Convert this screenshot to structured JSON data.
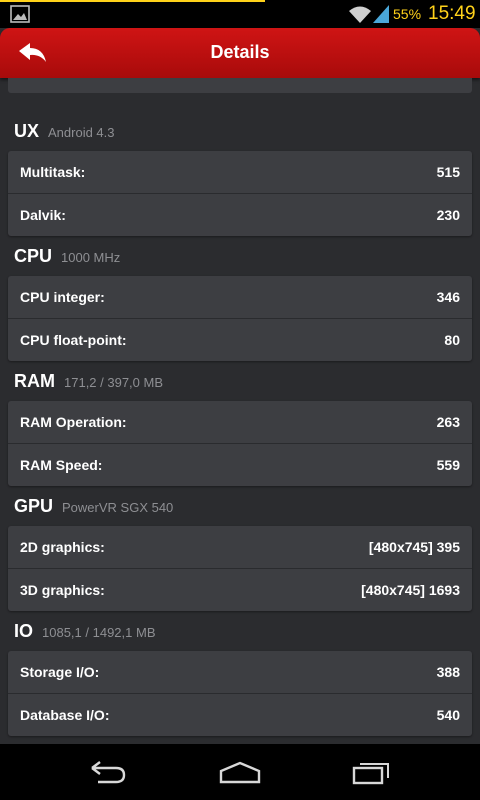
{
  "status_bar": {
    "battery_percent": "55%",
    "time": "15:49",
    "icons": [
      "gallery-icon",
      "wifi-icon",
      "signal-icon"
    ]
  },
  "header": {
    "title": "Details",
    "back_icon": "back-arrow-icon"
  },
  "sections": [
    {
      "title": "UX",
      "subtitle": "Android 4.3",
      "rows": [
        {
          "label": "Multitask:",
          "value": "515"
        },
        {
          "label": "Dalvik:",
          "value": "230"
        }
      ]
    },
    {
      "title": "CPU",
      "subtitle": "1000 MHz",
      "rows": [
        {
          "label": "CPU integer:",
          "value": "346"
        },
        {
          "label": "CPU float-point:",
          "value": "80"
        }
      ]
    },
    {
      "title": "RAM",
      "subtitle": "171,2 / 397,0 MB",
      "rows": [
        {
          "label": "RAM Operation:",
          "value": "263"
        },
        {
          "label": "RAM Speed:",
          "value": "559"
        }
      ]
    },
    {
      "title": "GPU",
      "subtitle": "PowerVR SGX 540",
      "rows": [
        {
          "label": "2D graphics:",
          "value": "[480x745] 395"
        },
        {
          "label": "3D graphics:",
          "value": "[480x745] 1693"
        }
      ]
    },
    {
      "title": "IO",
      "subtitle": "1085,1 / 1492,1 MB",
      "rows": [
        {
          "label": "Storage I/O:",
          "value": "388"
        },
        {
          "label": "Database I/O:",
          "value": "540"
        }
      ]
    }
  ],
  "nav_bar": {
    "icons": [
      "back-icon",
      "home-icon",
      "recents-icon"
    ]
  },
  "colors": {
    "header_red": "#c41010",
    "status_accent": "#ffd21a",
    "background": "#2b2c2f",
    "card": "#3d3e42"
  }
}
